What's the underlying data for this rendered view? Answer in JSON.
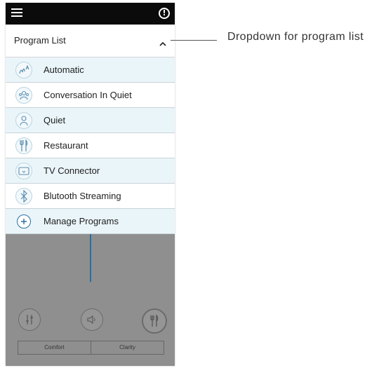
{
  "header": {
    "dropdown_title": "Program List"
  },
  "programs": [
    {
      "label": "Automatic",
      "icon": "automatic-icon"
    },
    {
      "label": "Conversation In Quiet",
      "icon": "conversation-icon"
    },
    {
      "label": "Quiet",
      "icon": "quiet-icon"
    },
    {
      "label": "Restaurant",
      "icon": "restaurant-icon"
    },
    {
      "label": "TV Connector",
      "icon": "tv-connector-icon"
    },
    {
      "label": "Blutooth Streaming",
      "icon": "bluetooth-icon"
    },
    {
      "label": "Manage Programs",
      "icon": "plus-circle-icon"
    }
  ],
  "controls": {
    "segment_left": "Comfort",
    "segment_right": "Clarity"
  },
  "annotation": {
    "callout": "Dropdown for program list"
  },
  "colors": {
    "accent": "#2a6fa0",
    "row_alt": "#eaf5fa",
    "dim_overlay": "#8f8f8f"
  }
}
